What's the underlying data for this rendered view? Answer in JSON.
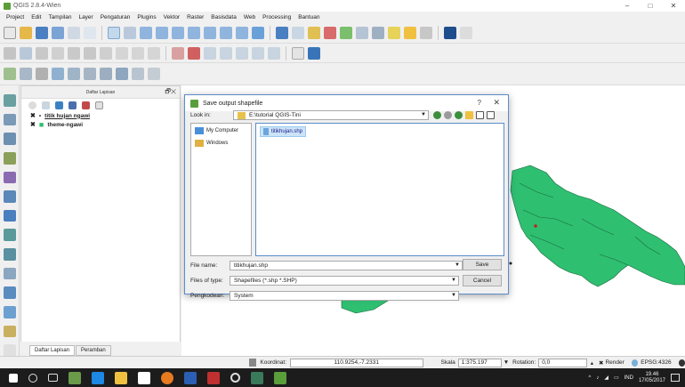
{
  "window": {
    "title": "QGIS 2.8.4-Wien",
    "min": "–",
    "max": "□",
    "close": "✕"
  },
  "menu": [
    "Project",
    "Edit",
    "Tampilan",
    "Layer",
    "Pengaturan",
    "Plugins",
    "Vektor",
    "Raster",
    "Basisdata",
    "Web",
    "Processing",
    "Bantuan"
  ],
  "layers_panel": {
    "title": "Daftar Lapisan",
    "controls": "🗗✕",
    "layers": [
      {
        "name": "titik hujan ngawi",
        "checked": "✖",
        "symbol": "•"
      },
      {
        "name": "theme-ngawi",
        "checked": "✖",
        "symbol": "■"
      }
    ],
    "tabs": [
      "Daftar Lapisan",
      "Peramban"
    ]
  },
  "dialog": {
    "title": "Save output shapefile",
    "help": "?",
    "close": "✕",
    "look_in_label": "Look in:",
    "look_in_value": "E:\\tutorial QGIS-Tini",
    "places": [
      "My Computer",
      "Windows"
    ],
    "files": [
      "titikhujan.shp"
    ],
    "file_name_label": "File name:",
    "file_name_value": "titikhujan.shp",
    "file_type_label": "Files of type:",
    "file_type_value": "Shapefiles (*.shp *.SHP)",
    "encoding_label": "Pengkodean:",
    "encoding_value": "System",
    "save_label": "Save",
    "cancel_label": "Cancel"
  },
  "status": {
    "coord_label": "Koordinat:",
    "coord_value": "110.9254,-7.2331",
    "scale_label": "Skala",
    "scale_value": "1:375.197",
    "rotation_label": "Rotation:",
    "rotation_value": "0,0",
    "render_label": "Render",
    "crs": "EPSG:4326"
  },
  "taskbar": {
    "lang": "IND",
    "time": "19.46",
    "date": "17/05/2017"
  },
  "colors": {
    "map_fill": "#2fbf71",
    "accent": "#5c8cc9"
  }
}
